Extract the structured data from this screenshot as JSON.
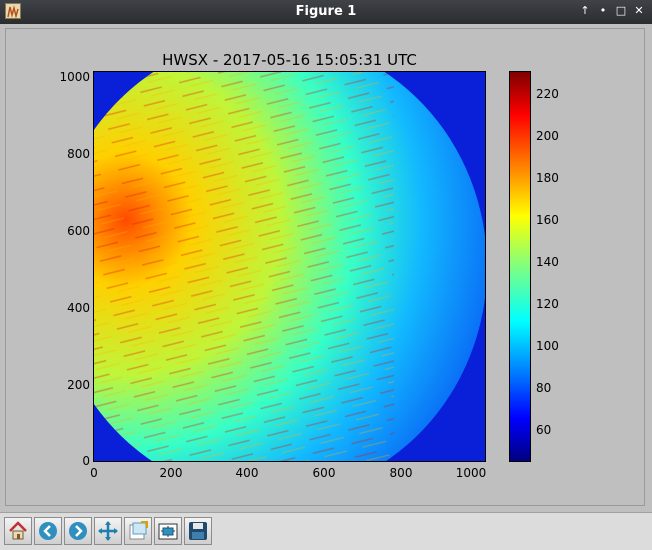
{
  "window": {
    "title": "Figure 1"
  },
  "window_buttons": {
    "above": "↑",
    "minimize": "•",
    "maximize": "□",
    "close": "✕"
  },
  "plot": {
    "title": "HWSX - 2017-05-16 15:05:31 UTC",
    "x_ticks": [
      "0",
      "200",
      "400",
      "600",
      "800",
      "1000"
    ],
    "y_ticks": [
      "1000",
      "800",
      "600",
      "400",
      "200",
      "0"
    ],
    "colorbar_ticks": [
      "220",
      "200",
      "180",
      "160",
      "140",
      "120",
      "100",
      "80",
      "60"
    ]
  },
  "chart_data": {
    "type": "heatmap",
    "title": "HWSX - 2017-05-16 15:05:31 UTC",
    "xlim": [
      0,
      1024
    ],
    "ylim": [
      0,
      1024
    ],
    "colorbar": {
      "min": 45,
      "max": 230,
      "colormap": "jet",
      "ticks": [
        60,
        80,
        100,
        120,
        140,
        160,
        180,
        200,
        220
      ]
    }
  },
  "toolbar": {
    "buttons": [
      "home-icon",
      "back-icon",
      "forward-icon",
      "pan-icon",
      "zoom-icon",
      "configure-subplots-icon",
      "save-icon"
    ]
  },
  "colors": {
    "titlebar": "#2f3136",
    "background": "#bfbfbf",
    "toolbar": "#dcdcdc"
  }
}
